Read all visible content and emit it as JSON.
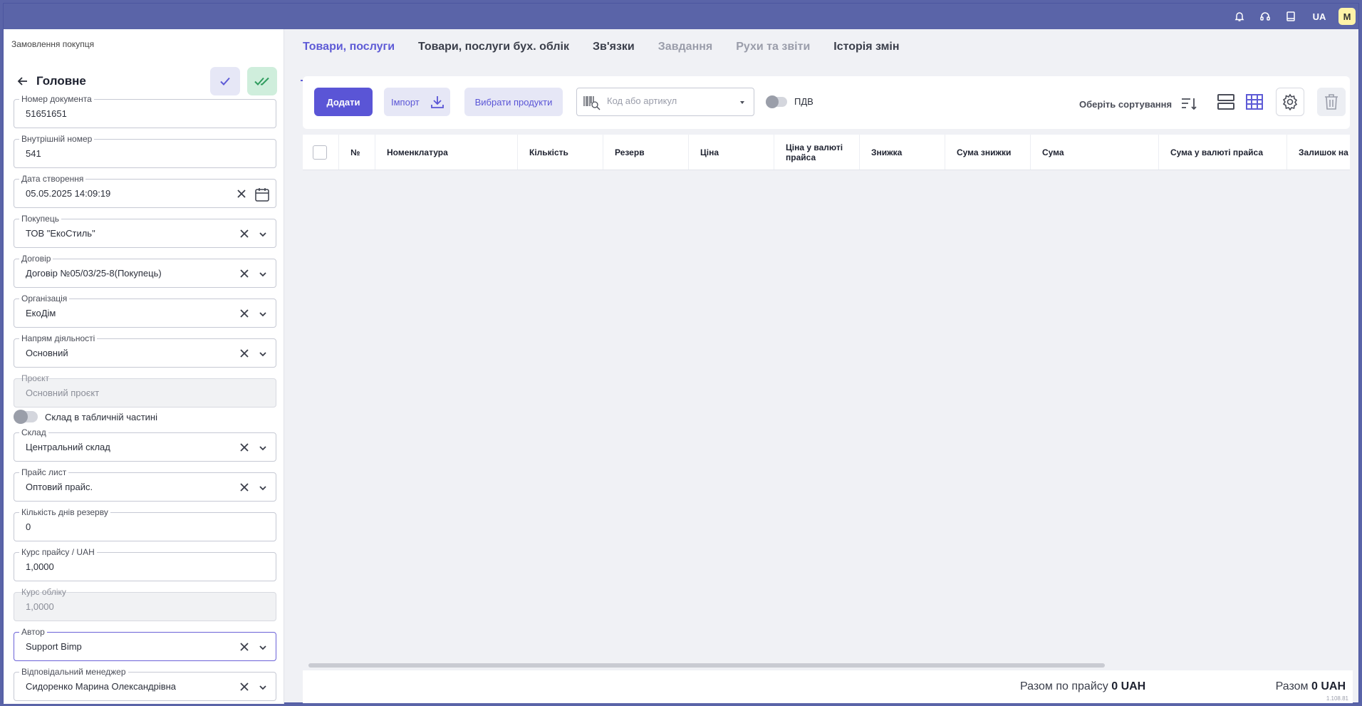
{
  "topbar": {
    "lang": "UA",
    "avatar": "M",
    "icons": [
      "bell-icon",
      "headset-icon",
      "book-icon"
    ]
  },
  "breadcrumb": "Замовлення покупця",
  "section_title": "Головне",
  "fields": {
    "doc_number": {
      "label": "Номер документа",
      "value": "51651651"
    },
    "internal_number": {
      "label": "Внутрішній номер",
      "value": "541"
    },
    "created": {
      "label": "Дата створення",
      "value": "05.05.2025 14:09:19"
    },
    "buyer": {
      "label": "Покупець",
      "value": "ТОВ \"ЕкоСтиль\""
    },
    "contract": {
      "label": "Договір",
      "value": "Договір №05/03/25-8(Покупець)"
    },
    "organization": {
      "label": "Організація",
      "value": "ЕкоДім"
    },
    "activity": {
      "label": "Напрям діяльності",
      "value": "Основний"
    },
    "project": {
      "label": "Проєкт",
      "value": "Основний проєкт"
    },
    "warehouse_toggle": "Склад в табличній частині",
    "warehouse": {
      "label": "Склад",
      "value": "Центральний склад"
    },
    "price_list": {
      "label": "Прайс лист",
      "value": "Оптовий прайс."
    },
    "reserve_days": {
      "label": "Кількість днів резерву",
      "value": "0"
    },
    "price_rate": {
      "label": "Курс прайсу / UAH",
      "value": "1,0000"
    },
    "accounting_rate": {
      "label": "Курс обліку",
      "value": "1,0000"
    },
    "author": {
      "label": "Автор",
      "value": "Support Bimp"
    },
    "manager": {
      "label": "Відповідальний менеджер",
      "value": "Сидоренко Марина Олександрівна"
    }
  },
  "tabs": [
    {
      "label": "Товари, послуги",
      "state": "active"
    },
    {
      "label": "Товари, послуги бух. облік",
      "state": "normal"
    },
    {
      "label": "Зв'язки",
      "state": "normal"
    },
    {
      "label": "Завдання",
      "state": "disabled"
    },
    {
      "label": "Рухи та звіти",
      "state": "disabled"
    },
    {
      "label": "Історія змін",
      "state": "normal"
    }
  ],
  "toolbar": {
    "add": "Додати",
    "import": "Імпорт",
    "select_products": "Вибрати продукти",
    "search_placeholder": "Код або артикул",
    "vat": "ПДВ",
    "sort": "Оберіть сортування"
  },
  "table": {
    "columns": [
      "№",
      "Номенклатура",
      "Кількість",
      "Резерв",
      "Ціна",
      "Ціна у валюті прайса",
      "Знижка",
      "Сума знижки",
      "Сума",
      "Сума у валюті прайса",
      "Залишок на с"
    ]
  },
  "totals": {
    "price_label": "Разом по прайсу",
    "price_value": "0 UAH",
    "total_label": "Разом",
    "total_value": "0 UAH",
    "version": "1.108.81"
  },
  "colors": {
    "accent": "#5e5bd6",
    "topbar": "#5a64a8",
    "confirm_green": "#cfeedc"
  }
}
